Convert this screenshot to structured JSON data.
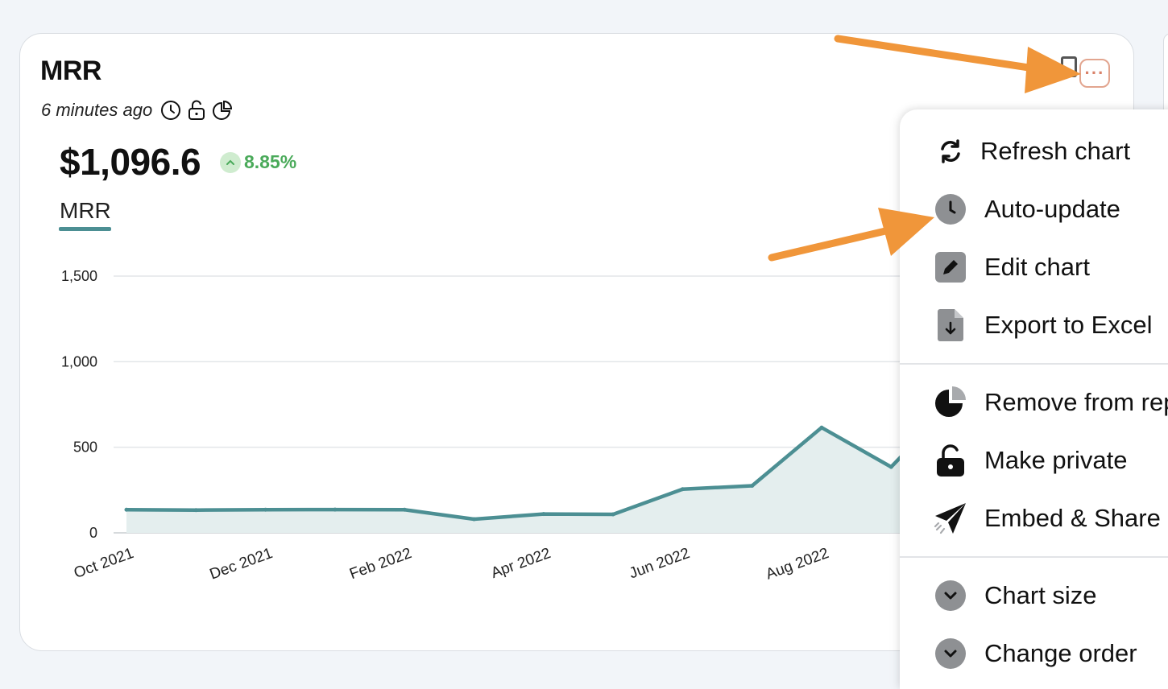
{
  "card": {
    "title": "MRR",
    "updated_ago": "6 minutes ago",
    "metric_value": "$1,096.6",
    "delta_percent": "8.85%",
    "legend_label": "MRR"
  },
  "menu": {
    "items": [
      {
        "label": "Refresh chart",
        "icon": "refresh-icon"
      },
      {
        "label": "Auto-update",
        "icon": "clock-icon"
      },
      {
        "label": "Edit chart",
        "icon": "pencil-icon"
      },
      {
        "label": "Export to Excel",
        "icon": "download-file-icon"
      },
      {
        "label": "Remove from rep",
        "icon": "pie-chart-icon"
      },
      {
        "label": "Make private",
        "icon": "lock-icon"
      },
      {
        "label": "Embed & Share",
        "icon": "paper-plane-icon"
      },
      {
        "label": "Chart size",
        "icon": "chevron-down-icon"
      },
      {
        "label": "Change order",
        "icon": "chevron-down-icon"
      }
    ]
  },
  "colors": {
    "series_line": "#4c8f93",
    "series_fill": "#e4eeee",
    "delta_green": "#4aaa5a",
    "annotation_arrow": "#f0963a"
  },
  "chart_data": {
    "type": "area",
    "x": [
      "Oct 2021",
      "Nov 2021",
      "Dec 2021",
      "Jan 2022",
      "Feb 2022",
      "Mar 2022",
      "Apr 2022",
      "May 2022",
      "Jun 2022",
      "Jul 2022",
      "Aug 2022",
      "Sep 2022"
    ],
    "x_ticks": [
      "Oct 2021",
      "Dec 2021",
      "Feb 2022",
      "Apr 2022",
      "Jun 2022",
      "Aug 2022"
    ],
    "series": [
      {
        "name": "MRR",
        "values": [
          135,
          133,
          135,
          136,
          135,
          80,
          110,
          108,
          255,
          275,
          615,
          385
        ]
      }
    ],
    "y_ticks": [
      0,
      500,
      1000,
      1500
    ],
    "y_tick_labels": [
      "0",
      "500",
      "1,000",
      "1,500"
    ],
    "ylim": [
      0,
      1500
    ],
    "grid": true,
    "legend": "top-left"
  }
}
